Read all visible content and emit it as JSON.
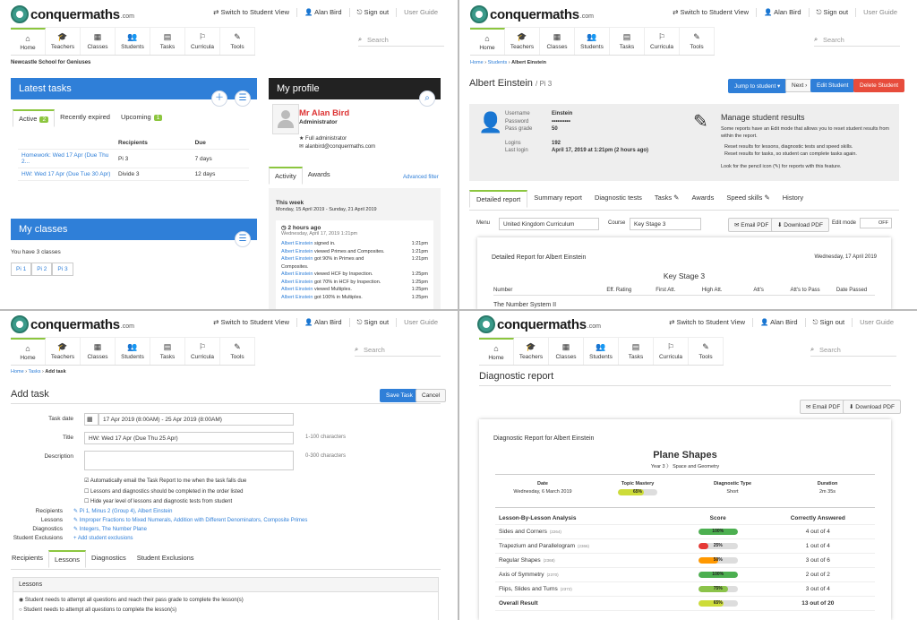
{
  "common": {
    "logo_text": "conquermaths",
    "logo_sub": ".com",
    "switch_label": "Switch to Student View",
    "user_name": "Alan Bird",
    "sign_out": "Sign out",
    "user_guide": "User Guide",
    "search_placeholder": "Search",
    "nav": [
      {
        "label": "Home",
        "icon": "⌂"
      },
      {
        "label": "Teachers",
        "icon": "🎓"
      },
      {
        "label": "Classes",
        "icon": "▦"
      },
      {
        "label": "Students",
        "icon": "👥"
      },
      {
        "label": "Tasks",
        "icon": "▤"
      },
      {
        "label": "Curricula",
        "icon": "⚐"
      },
      {
        "label": "Tools",
        "icon": "✎"
      }
    ]
  },
  "home": {
    "school": "Newcastle School for Geniuses",
    "latest_tasks": "Latest tasks",
    "tabs": [
      {
        "label": "Active",
        "count": "2"
      },
      {
        "label": "Recently expired",
        "count": ""
      },
      {
        "label": "Upcoming",
        "count": "1"
      }
    ],
    "cols": [
      "Recipients",
      "Due"
    ],
    "tasks": [
      {
        "name": "Homework: Wed 17 Apr (Due Thu 2...",
        "recipients": "Pi 3",
        "due": "7 days"
      },
      {
        "name": "HW: Wed 17 Apr (Due Tue 30 Apr)",
        "recipients": "Divide 3",
        "due": "12 days"
      }
    ],
    "my_classes": "My classes",
    "classes_count": "You have 3 classes",
    "classes": [
      "Pi 1",
      "Pi 2",
      "Pi 3"
    ],
    "my_profile": "My profile",
    "profile_name": "Mr Alan Bird",
    "profile_role": "Administrator",
    "profile_full": "Full administrator",
    "profile_email": "alanbird@conquermaths.com",
    "activity_tabs": [
      "Activity",
      "Awards"
    ],
    "advanced_filter": "Advanced filter",
    "this_week": "This week",
    "week_range": "Monday, 15 April 2019 - Sunday, 21 April 2019",
    "ago": "2 hours ago",
    "ago_date": "Wednesday, April 17, 2019 1:21pm",
    "activity": [
      {
        "who": "Albert Einstein",
        "what": " signed in.",
        "time": "1:21pm"
      },
      {
        "who": "Albert Einstein",
        "what": " viewed Primes and Composites.",
        "time": "1:21pm"
      },
      {
        "who": "Albert Einstein",
        "what": " got 90% in Primes and Composites.",
        "time": "1:21pm"
      },
      {
        "who": "Albert Einstein",
        "what": " viewed HCF by Inspection.",
        "time": "1:25pm"
      },
      {
        "who": "Albert Einstein",
        "what": " got 70% in HCF by Inspection.",
        "time": "1:25pm"
      },
      {
        "who": "Albert Einstein",
        "what": " viewed Multiples.",
        "time": "1:25pm"
      },
      {
        "who": "Albert Einstein",
        "what": " got 100% in Multiples.",
        "time": "1:25pm"
      }
    ]
  },
  "student": {
    "breadcrumb": [
      "Home",
      "Students",
      "Albert Einstein"
    ],
    "name": "Albert Einstein",
    "class": "/ Pi 3",
    "jump": "Jump to student ▾",
    "next": "Next ›",
    "edit": "Edit Student",
    "delete": "Delete Student",
    "fields": [
      {
        "k": "Username",
        "v": "Einstein"
      },
      {
        "k": "Password",
        "v": "••••••••••"
      },
      {
        "k": "Pass grade",
        "v": "50"
      },
      {
        "k": "Logins",
        "v": "192"
      },
      {
        "k": "Last login",
        "v": "April 17, 2019 at 1:21pm (2 hours ago)"
      }
    ],
    "manage_title": "Manage student results",
    "manage_text": "Some reports have an Edit mode that allows you to reset student results from within the report.",
    "manage_bullets": [
      "Reset results for lessons, diagnostic tests and speed skills.",
      "Reset results for tasks, so student can complete tasks again."
    ],
    "manage_foot": "Look for the pencil icon (✎) for reports with this feature.",
    "tabs": [
      "Detailed report",
      "Summary report",
      "Diagnostic tests",
      "Tasks ✎",
      "Awards",
      "Speed skills ✎",
      "History"
    ],
    "menu_label": "Menu",
    "menu_value": "United Kingdom Curriculum",
    "course_label": "Course",
    "course_value": "Key Stage 3",
    "email_pdf": "✉ Email PDF",
    "download_pdf": "⬇ Download PDF",
    "edit_mode": "Edit mode",
    "off": "OFF",
    "report_title": "Detailed Report for Albert Einstein",
    "report_date": "Wednesday, 17 April 2019",
    "report_stage": "Key Stage 3",
    "report_cols": [
      "Number",
      "Eff. Rating",
      "First Att.",
      "High Att.",
      "Att's",
      "Att's to Pass",
      "Date Passed"
    ],
    "report_section": "The Number System II"
  },
  "addtask": {
    "breadcrumb": [
      "Home",
      "Tasks",
      "Add task"
    ],
    "title": "Add task",
    "save": "Save Task",
    "cancel": "Cancel",
    "task_date_label": "Task date",
    "task_date": "17 Apr 2019 (8:00AM) - 25 Apr 2019 (8:00AM)",
    "title_label": "Title",
    "title_value": "HW: Wed 17 Apr (Due Thu 25 Apr)",
    "title_hint": "1-100 characters",
    "desc_label": "Description",
    "desc_hint": "0-300 characters",
    "checks": [
      "Automatically email the Task Report to me when the task falls due",
      "Lessons and diagnostics should be completed in the order listed",
      "Hide year level of lessons and diagnostic tests from student"
    ],
    "recipients_label": "Recipients",
    "recipients": "Pi 1, Minus 2 (Group 4), Albert Einstein",
    "lessons_label": "Lessons",
    "lessons": "Improper Fractions to Mixed Numerals, Addition with Different Denominators, Composite Primes",
    "diagnostics_label": "Diagnostics",
    "diagnostics": "Integers, The Number Plane",
    "exclusions_label": "Student Exclusions",
    "exclusions": "+ Add student exclusions",
    "tabs": [
      "Recipients",
      "Lessons",
      "Diagnostics",
      "Student Exclusions"
    ],
    "panel_title": "Lessons",
    "radios": [
      "Student needs to attempt all questions and reach their pass grade to complete the lesson(s)",
      "Student needs to attempt all questions to complete the lesson(s)"
    ]
  },
  "diag": {
    "title": "Diagnostic report",
    "email_pdf": "✉ Email PDF",
    "download_pdf": "⬇ Download PDF",
    "report_for": "Diagnostic Report for Albert Einstein",
    "topic": "Plane Shapes",
    "year": "Year 3",
    "strand": "Space and Geometry",
    "meta": [
      {
        "k": "Date",
        "v": "Wednesday, 6 March 2019"
      },
      {
        "k": "Topic Mastery",
        "v": "65%"
      },
      {
        "k": "Diagnostic Type",
        "v": "Short"
      },
      {
        "k": "Duration",
        "v": "2m 35s"
      }
    ],
    "cols": [
      "Lesson-By-Lesson Analysis",
      "Score",
      "Correctly Answered"
    ],
    "rows": [
      {
        "lesson": "Sides and Corners",
        "code": "(2264)",
        "score": "100%",
        "pct": 100,
        "color": "#4caf50",
        "answered": "4 out of 4"
      },
      {
        "lesson": "Trapezium and Parallelogram",
        "code": "(2366)",
        "score": "25%",
        "pct": 25,
        "color": "#e53935",
        "answered": "1 out of 4"
      },
      {
        "lesson": "Regular Shapes",
        "code": "(2368)",
        "score": "50%",
        "pct": 50,
        "color": "#ff9800",
        "answered": "3 out of 6"
      },
      {
        "lesson": "Axis of Symmetry",
        "code": "(2370)",
        "score": "100%",
        "pct": 100,
        "color": "#4caf50",
        "answered": "2 out of 2"
      },
      {
        "lesson": "Flips, Slides and Turns",
        "code": "(2372)",
        "score": "75%",
        "pct": 75,
        "color": "#8bc34a",
        "answered": "3 out of 4"
      },
      {
        "lesson": "Overall Result",
        "code": "",
        "score": "65%",
        "pct": 65,
        "color": "#cddc39",
        "answered": "13 out of 20"
      }
    ]
  },
  "colors": {
    "accent": "#2f7fd8",
    "green": "#8cc63f",
    "dark": "#222",
    "red": "#e74c3c"
  }
}
